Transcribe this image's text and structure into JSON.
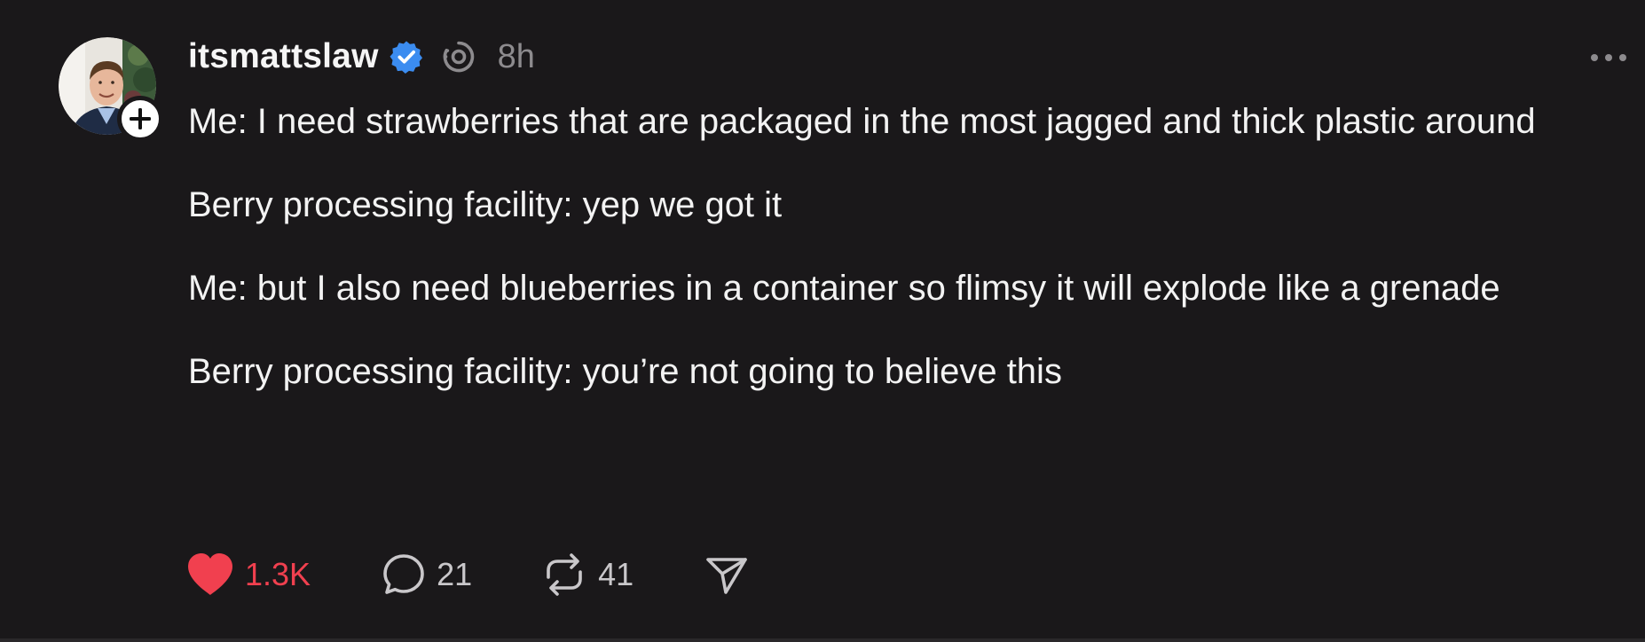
{
  "post": {
    "author": {
      "username": "itsmattslaw",
      "verified": true,
      "avatar_icon": "profile-photo",
      "follow_icon": "plus-icon"
    },
    "timestamp": "8h",
    "paragraphs": [
      "Me: I need strawberries that are packaged in the most jagged and thick plastic around",
      "Berry processing facility: yep we got it",
      "Me: but I also need blueberries in a container so flimsy it will explode like a grenade",
      "Berry processing facility: you’re not going to believe this"
    ],
    "actions": {
      "like_count": "1.3K",
      "reply_count": "21",
      "repost_count": "41"
    }
  },
  "colors": {
    "background": "#1a181a",
    "text": "#f3f3f3",
    "muted": "#8d8b8e",
    "like": "#f1404f",
    "verified": "#3b8cf0"
  }
}
